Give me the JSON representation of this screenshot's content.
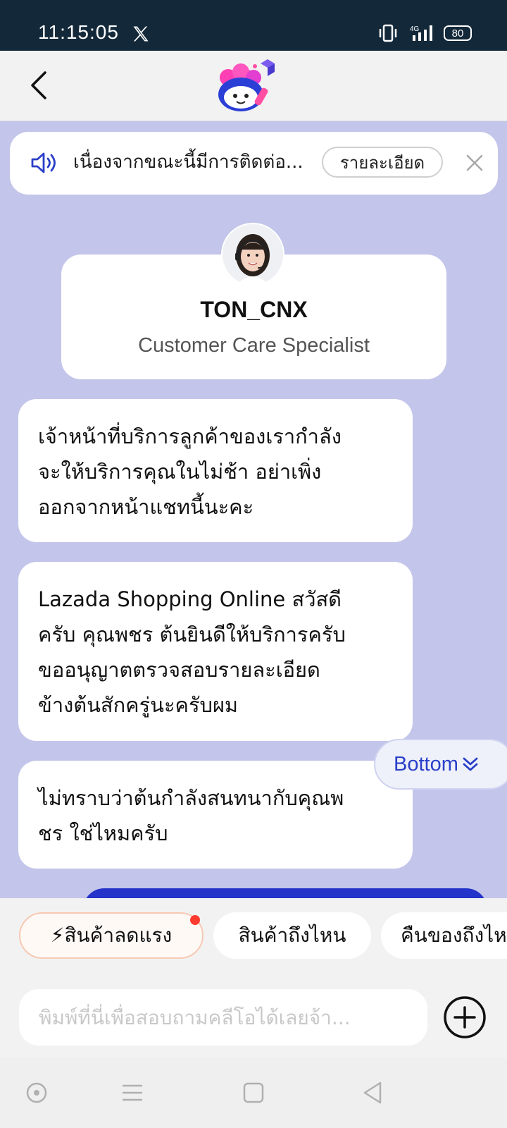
{
  "status": {
    "time": "11:15:05",
    "battery": "80"
  },
  "notice": {
    "text": "เนื่องจากขณะนี้มีการติดต่อ...",
    "detail_label": "รายละเอียด"
  },
  "agent": {
    "name": "TON_CNX",
    "role": "Customer Care Specialist"
  },
  "messages": [
    {
      "lines": [
        "เจ้าหน้าที่บริการลูกค้าของเรากำลัง",
        "จะให้บริการคุณในไม่ช้า อย่าเพิ่ง",
        "ออกจากหน้าแชทนี้นะคะ"
      ]
    },
    {
      "lines": [
        "Lazada Shopping Online สวัสดี",
        "ครับ คุณพชร  ต้นยินดีให้บริการครับ",
        "ขออนุญาตตรวจสอบรายละเอียด",
        "ข้างต้นสักครู่นะครับผม"
      ]
    },
    {
      "lines": [
        "ไม่ทราบว่าต้นกำลังสนทนากับคุณพ",
        "ชร ใช่ไหมครับ"
      ]
    }
  ],
  "bottom_button": "Bottom",
  "quick_replies": [
    "⚡สินค้าลดแรง",
    "สินค้าถึงไหน",
    "คืนของถึงไห"
  ],
  "input": {
    "placeholder": "พิมพ์ที่นี่เพื่อสอบถามคลีโอได้เลยจ้า..."
  },
  "colors": {
    "chat_bg": "#c3c5ea",
    "accent_blue": "#2433c9",
    "status_bar": "#13293a"
  }
}
